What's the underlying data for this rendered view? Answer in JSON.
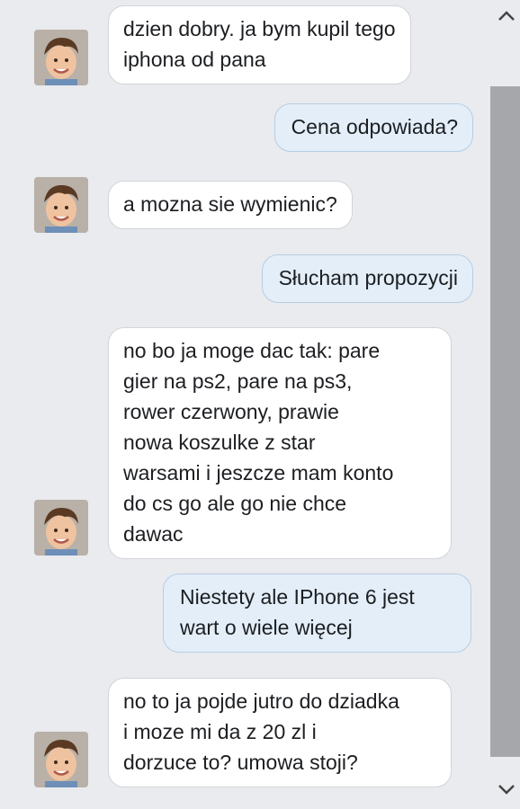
{
  "messages": [
    {
      "side": "in",
      "text": "dzien dobry. ja bym kupil tego\niphona od pana"
    },
    {
      "side": "out",
      "text": "Cena odpowiada?"
    },
    {
      "side": "in",
      "text": "a mozna sie wymienic?"
    },
    {
      "side": "out",
      "text": "Słucham propozycji"
    },
    {
      "side": "in",
      "text": "no bo ja moge dac tak: pare\ngier na ps2, pare na ps3,\nrower czerwony, prawie\nnowa koszulke z star\nwarsami i jeszcze mam konto\ndo cs go ale go nie chce\ndawac"
    },
    {
      "side": "out",
      "text": "Niestety ale IPhone 6 jest\nwart o wiele więcej"
    },
    {
      "side": "in",
      "text": "no to ja pojde jutro do dziadka\ni moze mi da z 20 zl i\ndorzuce to? umowa stoji?"
    }
  ],
  "icons": {
    "avatar": "child-avatar-icon",
    "scroll_up": "chevron-up-icon",
    "scroll_down": "chevron-down-icon"
  },
  "colors": {
    "background": "#e9ebee",
    "incoming_bubble": "#ffffff",
    "outgoing_bubble": "#e3eef9",
    "outgoing_border": "#b7cde4",
    "scroll_thumb": "#a5a7aa"
  }
}
